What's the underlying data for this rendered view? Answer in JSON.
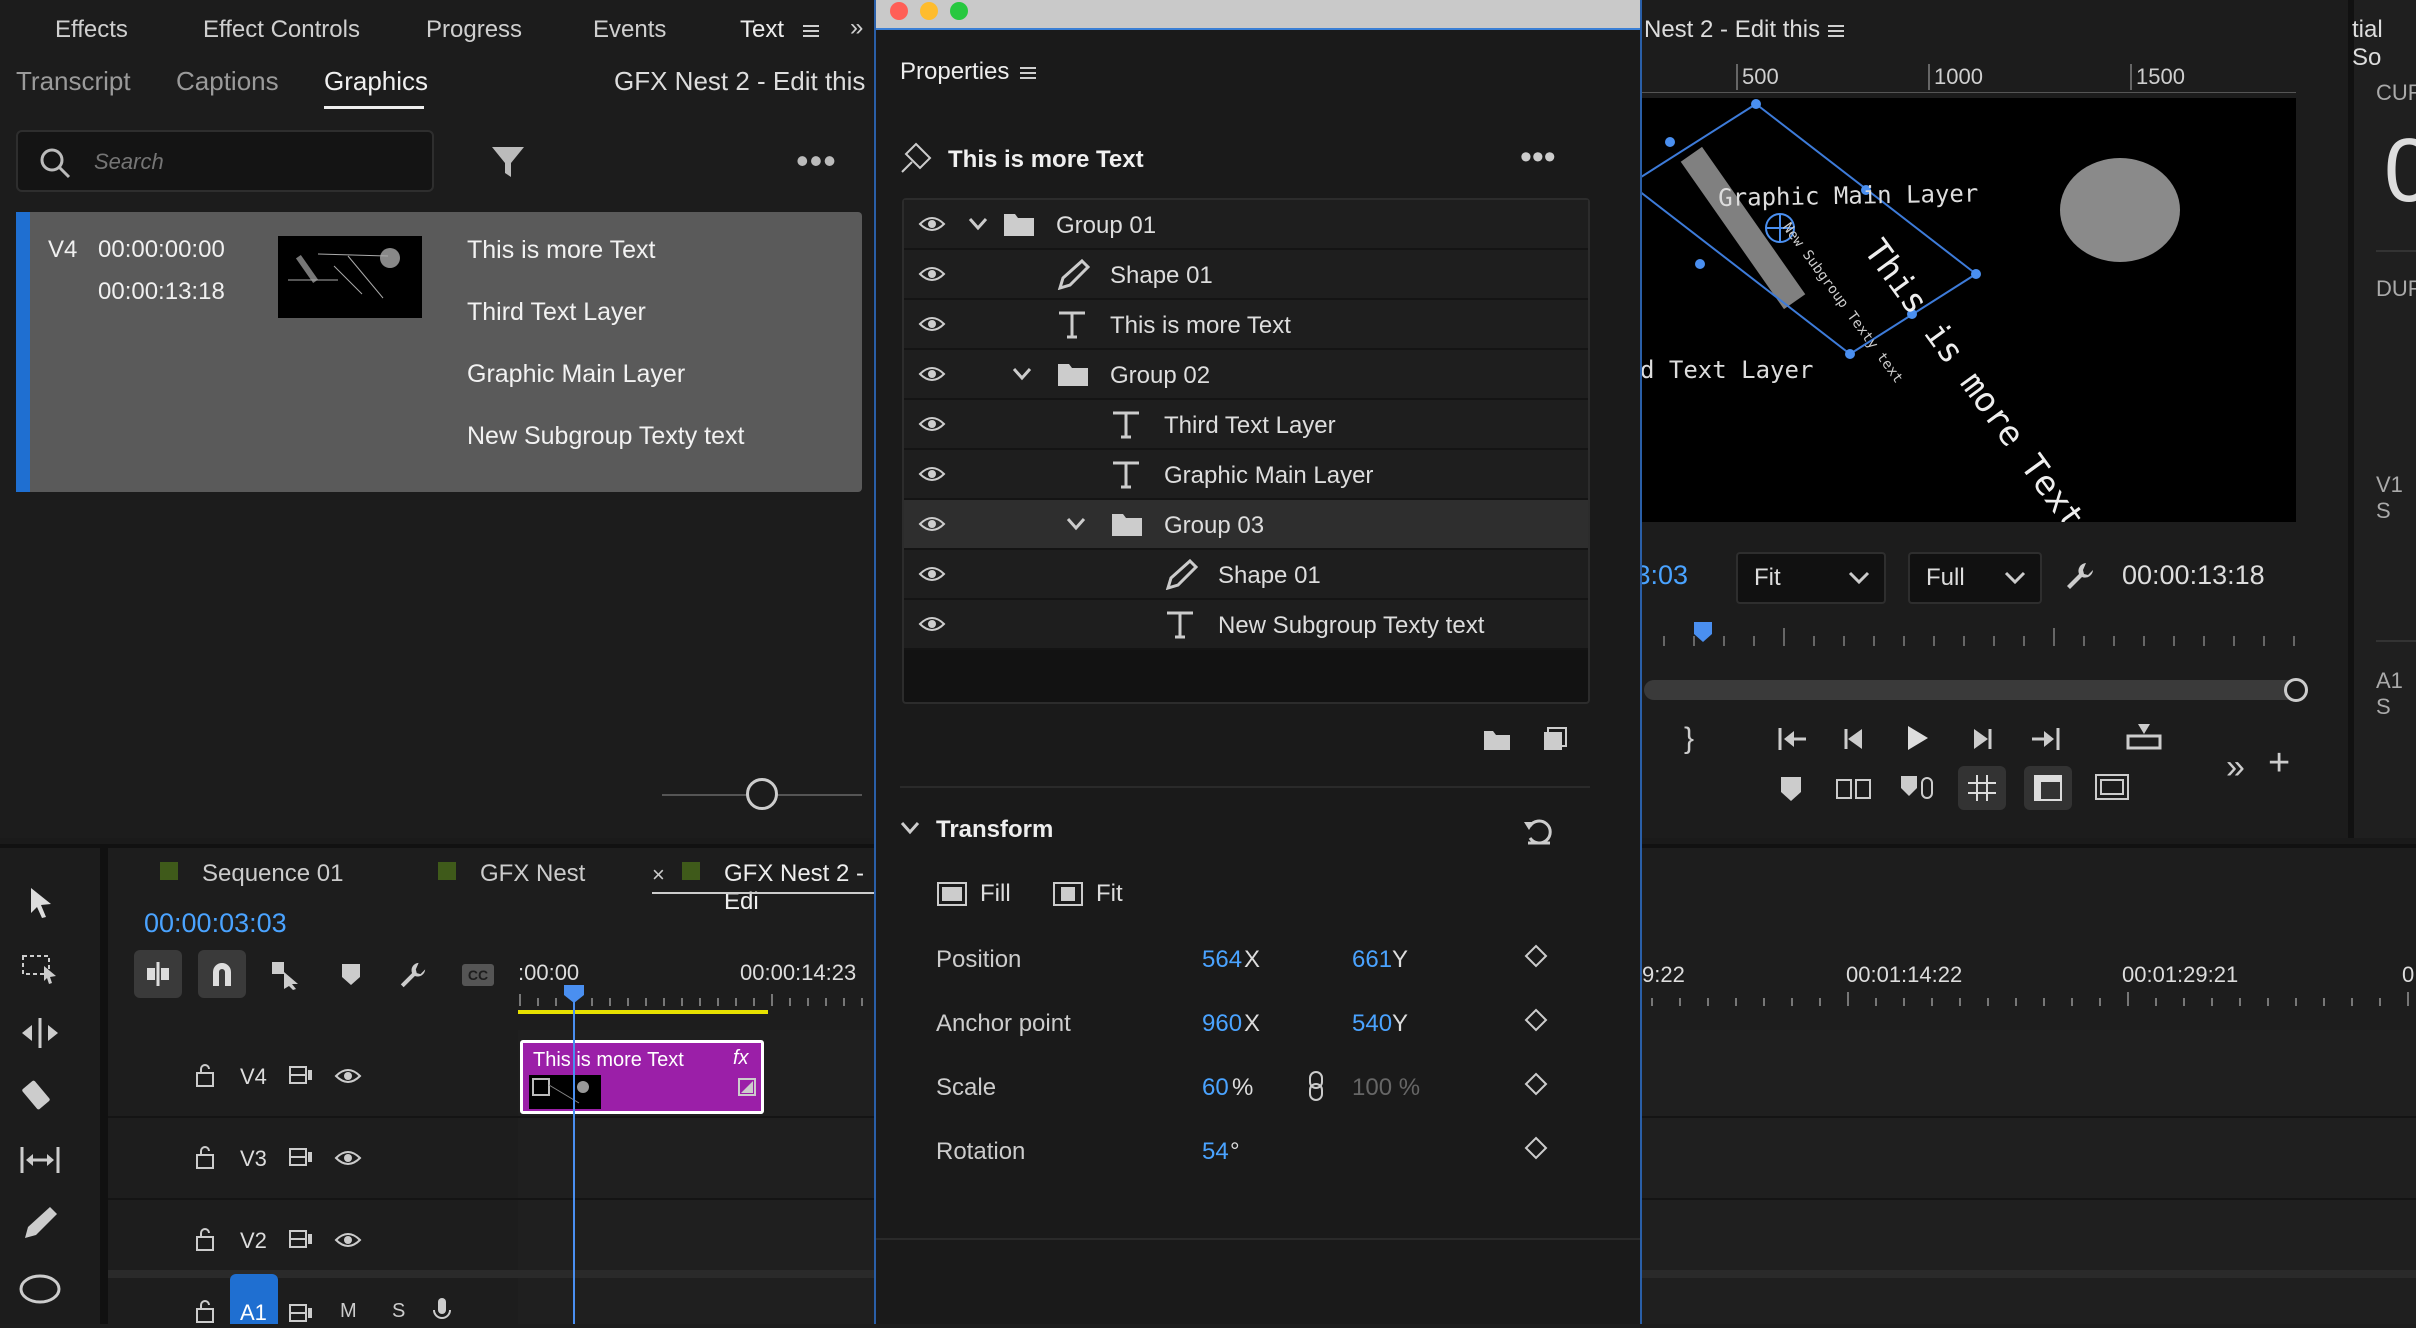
{
  "colors": {
    "accent": "#4aa3ff",
    "clip": "#9b1fa8",
    "playhead_yellow": "#e6e000",
    "track_select": "#1f6fd1",
    "bg": "#1a1a1a"
  },
  "top_tabs": [
    "Effects",
    "Effect Controls",
    "Progress",
    "Events",
    "Text"
  ],
  "essential_tabs": [
    "Transcript",
    "Captions",
    "Graphics"
  ],
  "essential_title": "GFX Nest 2 - Edit this",
  "search": {
    "placeholder": "Search"
  },
  "graphic_item": {
    "track": "V4",
    "in": "00:00:00:00",
    "out": "00:00:13:18",
    "layers": [
      "This is more Text",
      "Third Text Layer",
      "Graphic Main Layer",
      "New Subgroup Texty text"
    ]
  },
  "properties": {
    "title": "Properties",
    "selected": "This is more Text",
    "layers": [
      {
        "name": "Group 01",
        "type": "group",
        "depth": 0,
        "expanded": true
      },
      {
        "name": "Shape 01",
        "type": "shape",
        "depth": 1
      },
      {
        "name": "This is more Text",
        "type": "text",
        "depth": 1
      },
      {
        "name": "Group 02",
        "type": "group",
        "depth": 1,
        "expanded": true
      },
      {
        "name": "Third Text Layer",
        "type": "text",
        "depth": 2
      },
      {
        "name": "Graphic Main Layer",
        "type": "text",
        "depth": 2
      },
      {
        "name": "Group 03",
        "type": "group",
        "depth": 2,
        "expanded": true
      },
      {
        "name": "Shape 01",
        "type": "shape",
        "depth": 3
      },
      {
        "name": "New Subgroup Texty text",
        "type": "text",
        "depth": 3
      }
    ],
    "transform": {
      "label": "Transform",
      "fill": "Fill",
      "fit": "Fit",
      "position": {
        "label": "Position",
        "x": "564",
        "y": "661"
      },
      "anchor": {
        "label": "Anchor point",
        "x": "960",
        "y": "540"
      },
      "scale": {
        "label": "Scale",
        "value": "60",
        "unit": "%",
        "linked": "100 %"
      },
      "rotation": {
        "label": "Rotation",
        "value": "54",
        "unit": "°"
      },
      "x_label": "X",
      "y_label": "Y"
    }
  },
  "program": {
    "title": "Nest 2 - Edit this",
    "ruler": [
      "500",
      "1000",
      "1500"
    ],
    "timecode_left": ":3:03",
    "fit": "Fit",
    "full": "Full",
    "timecode_right": "00:00:13:18",
    "canvas_text": {
      "main": "Graphic Main Layer",
      "more": "This is more Text",
      "third": "d Text Layer",
      "sub": "New Subgroup Texty text"
    }
  },
  "right_edge": {
    "title": "tial So",
    "labels": [
      "CUR",
      "DUR",
      "V1 S",
      "A1 S"
    ],
    "big": "0"
  },
  "timeline": {
    "tabs": [
      "Sequence 01",
      "GFX Nest",
      "GFX Nest 2 - Edi"
    ],
    "timecode": "00:00:03:03",
    "ruler": [
      ":00:00",
      "00:00:14:23"
    ],
    "ruler_right": [
      "9:22",
      "00:01:14:22",
      "00:01:29:21",
      "0"
    ],
    "tracks": [
      "V4",
      "V3",
      "V2",
      "A1"
    ],
    "a1_btns": [
      "M",
      "S"
    ],
    "clip": {
      "label": "This is more Text",
      "fx": "fx"
    }
  }
}
